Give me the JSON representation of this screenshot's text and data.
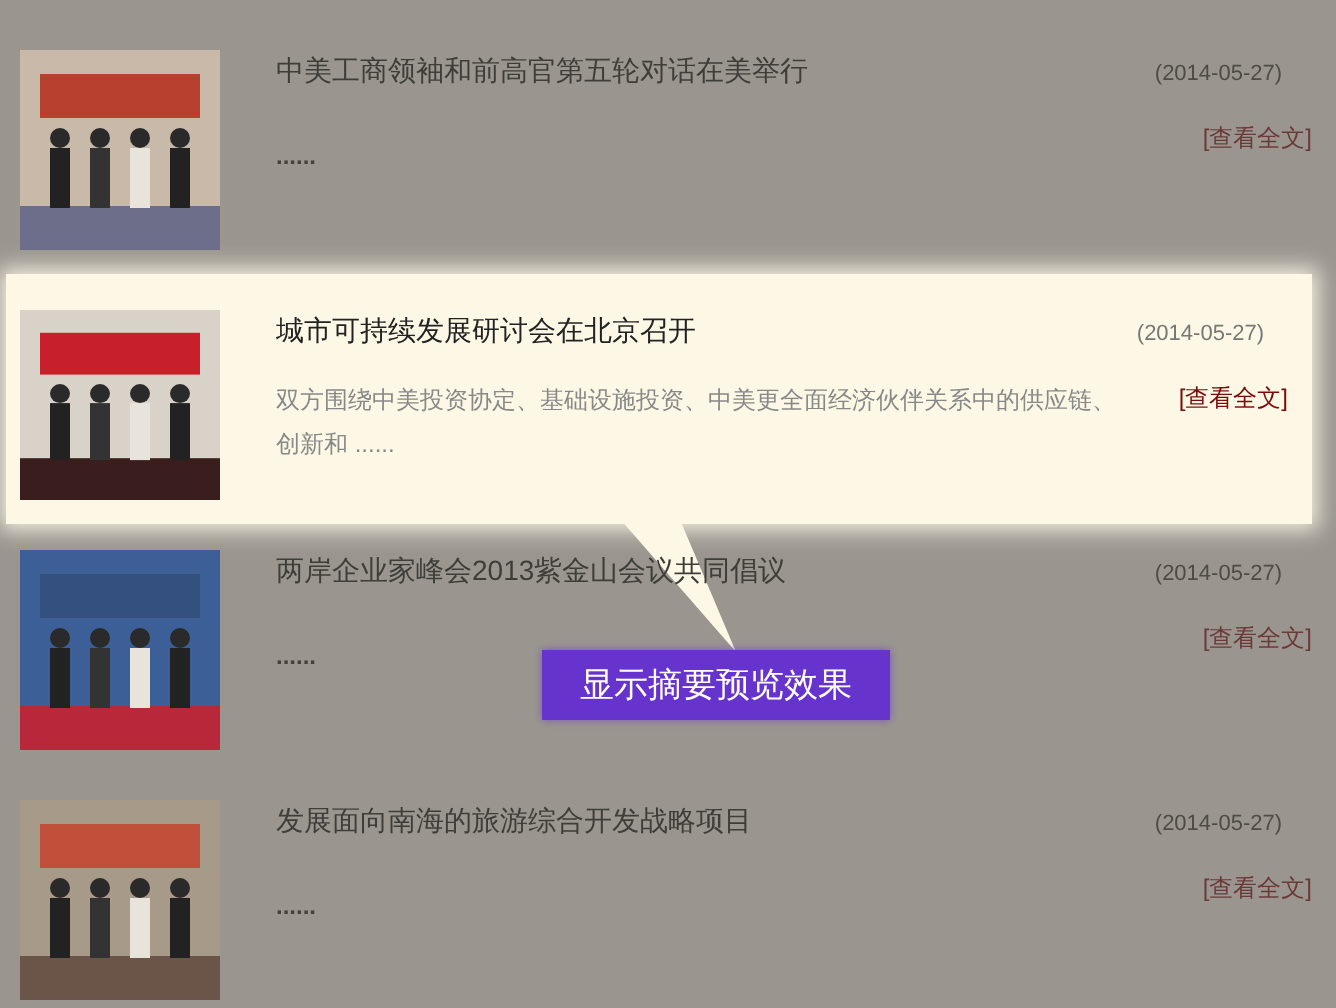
{
  "articles": [
    {
      "title": "中美工商领袖和前高官第五轮对话在美举行",
      "date": "(2014-05-27)",
      "summary": "......",
      "link": "[查看全文]",
      "highlighted": false
    },
    {
      "title": "城市可持续发展研讨会在北京召开",
      "date": "(2014-05-27)",
      "summary": "双方围绕中美投资协定、基础设施投资、中美更全面经济伙伴关系中的供应链、创新和  ......",
      "link": "[查看全文]",
      "highlighted": true
    },
    {
      "title": "两岸企业家峰会2013紫金山会议共同倡议",
      "date": "(2014-05-27)",
      "summary": "......",
      "link": "[查看全文]",
      "highlighted": false
    },
    {
      "title": "发展面向南海的旅游综合开发战略项目",
      "date": "(2014-05-27)",
      "summary": "......",
      "link": "[查看全文]",
      "highlighted": false
    }
  ],
  "callout": {
    "text": "显示摘要预览效果"
  }
}
